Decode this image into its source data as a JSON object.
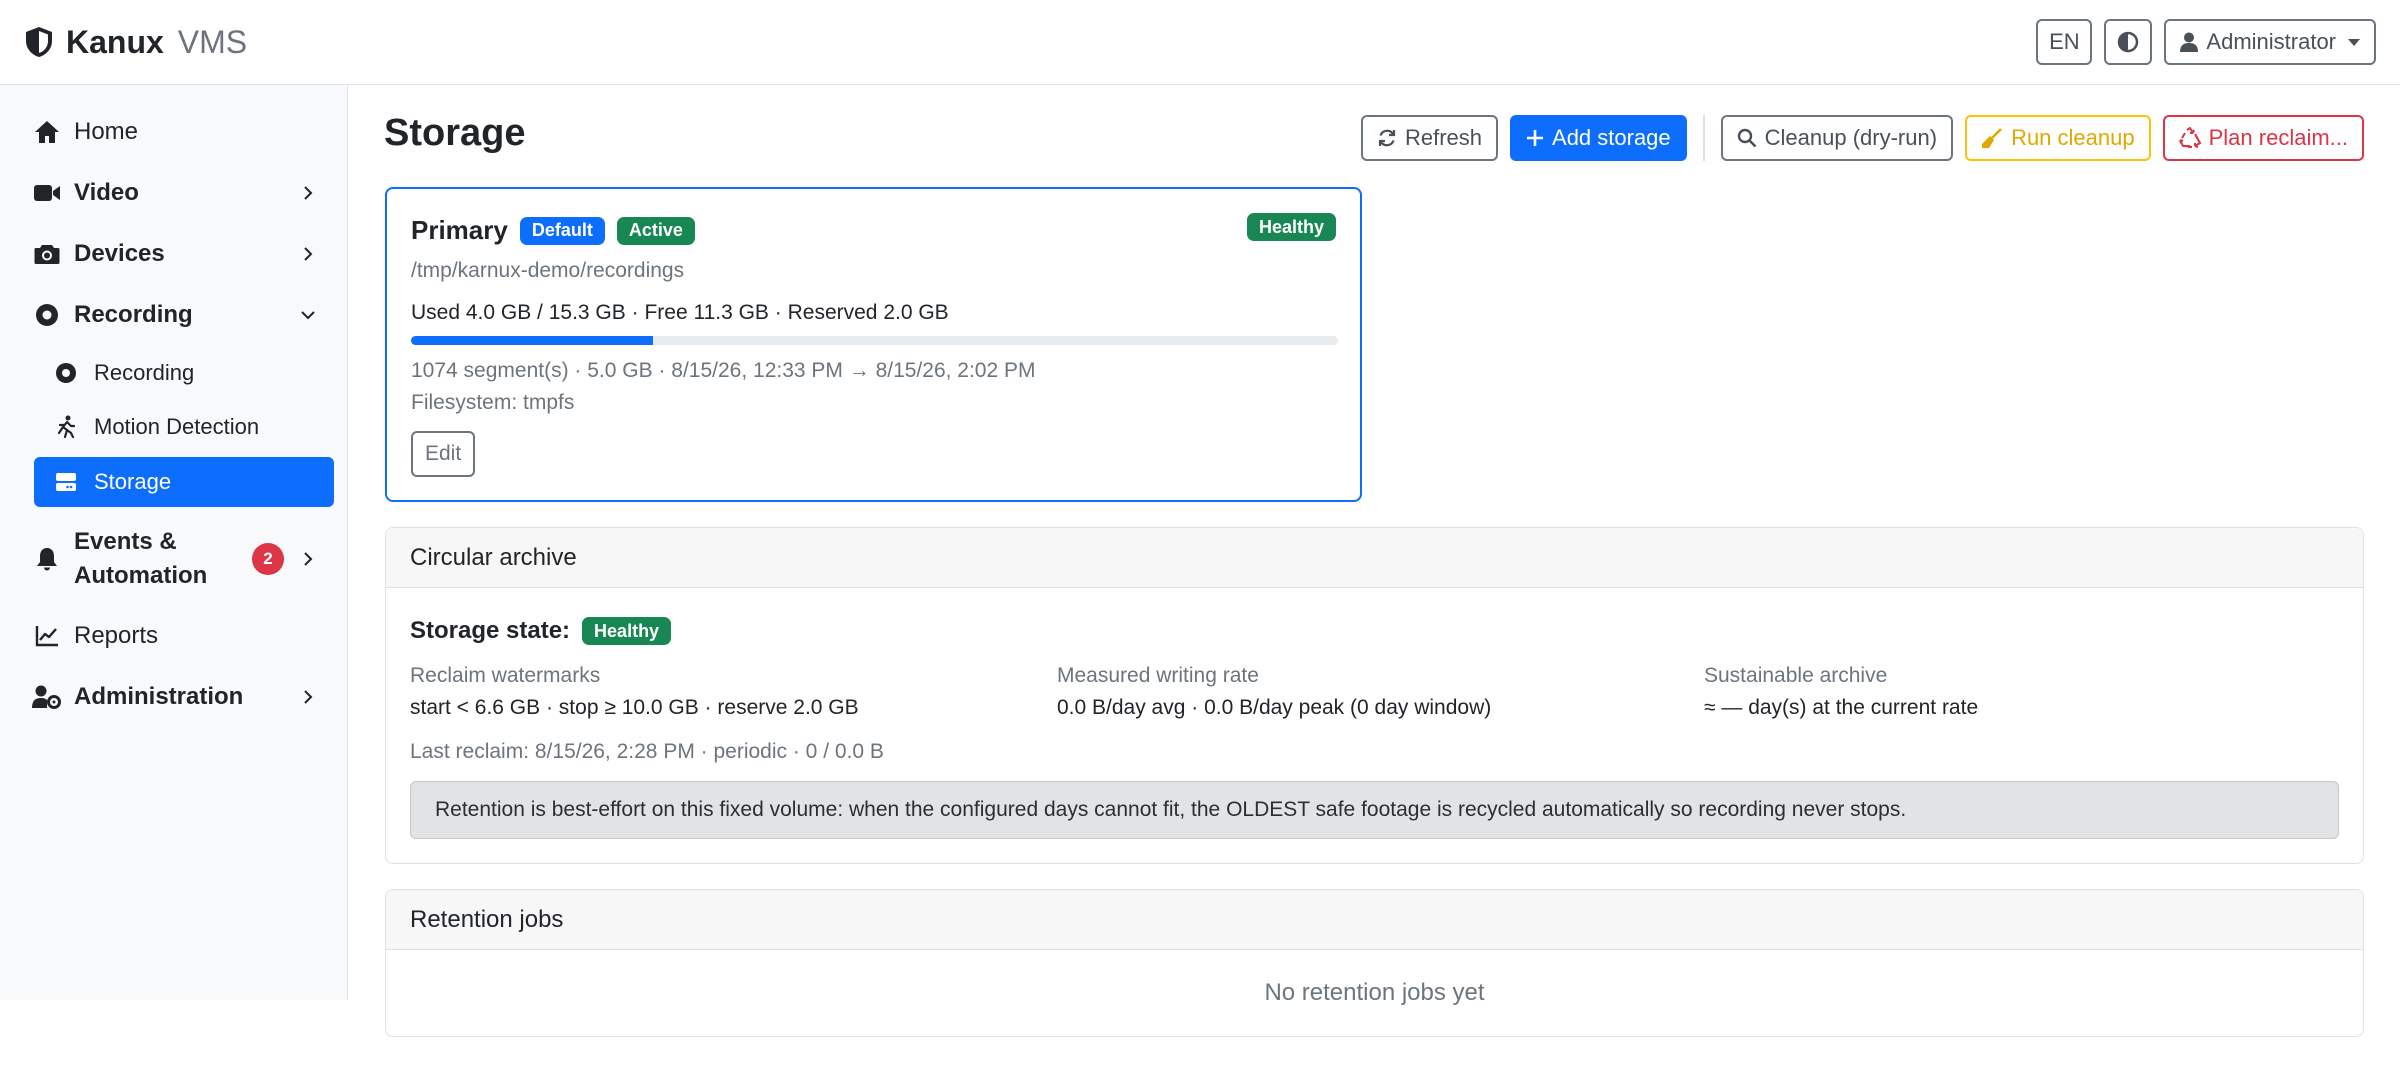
{
  "app": {
    "brand_name": "Kanux",
    "brand_sub": "VMS",
    "lang": "EN",
    "user": "Administrator"
  },
  "sidebar": {
    "items": [
      {
        "label": "Home"
      },
      {
        "label": "Video"
      },
      {
        "label": "Devices"
      },
      {
        "label": "Recording"
      },
      {
        "label": "Events & Automation",
        "badge": "2"
      },
      {
        "label": "Reports"
      },
      {
        "label": "Administration"
      }
    ],
    "recording_sub": [
      {
        "label": "Recording"
      },
      {
        "label": "Motion Detection"
      },
      {
        "label": "Storage",
        "active": true
      }
    ]
  },
  "page": {
    "title": "Storage",
    "actions": {
      "refresh": "Refresh",
      "add": "Add storage",
      "cleanup_dry": "Cleanup (dry-run)",
      "run_cleanup": "Run cleanup",
      "plan_reclaim": "Plan reclaim..."
    }
  },
  "storage": {
    "name": "Primary",
    "badge_default": "Default",
    "badge_active": "Active",
    "health": "Healthy",
    "path": "/tmp/karnux-demo/recordings",
    "usage": "Used 4.0 GB / 15.3 GB · Free 11.3 GB · Reserved 2.0 GB",
    "used_fraction": 0.261,
    "segments": "1074 segment(s) · 5.0 GB · 8/15/26, 12:33 PM → 8/15/26, 2:02 PM",
    "filesystem": "Filesystem: tmpfs",
    "edit": "Edit"
  },
  "archive": {
    "header": "Circular archive",
    "state_label": "Storage state:",
    "state": "Healthy",
    "watermarks_label": "Reclaim watermarks",
    "watermarks": "start < 6.6 GB · stop ≥ 10.0 GB · reserve 2.0 GB",
    "rate_label": "Measured writing rate",
    "rate": "0.0 B/day avg · 0.0 B/day peak (0 day window)",
    "sustain_label": "Sustainable archive",
    "sustain": "≈ — day(s) at the current rate",
    "last_reclaim": "Last reclaim: 8/15/26, 2:28 PM · periodic · 0 / 0.0 B",
    "note": "Retention is best-effort on this fixed volume: when the configured days cannot fit, the OLDEST safe footage is recycled automatically so recording never stops."
  },
  "jobs": {
    "header": "Retention jobs",
    "empty": "No retention jobs yet"
  },
  "colors": {
    "primary": "#0d6efd",
    "success": "#198754",
    "danger": "#dc3545",
    "warning": "#ffc107"
  }
}
